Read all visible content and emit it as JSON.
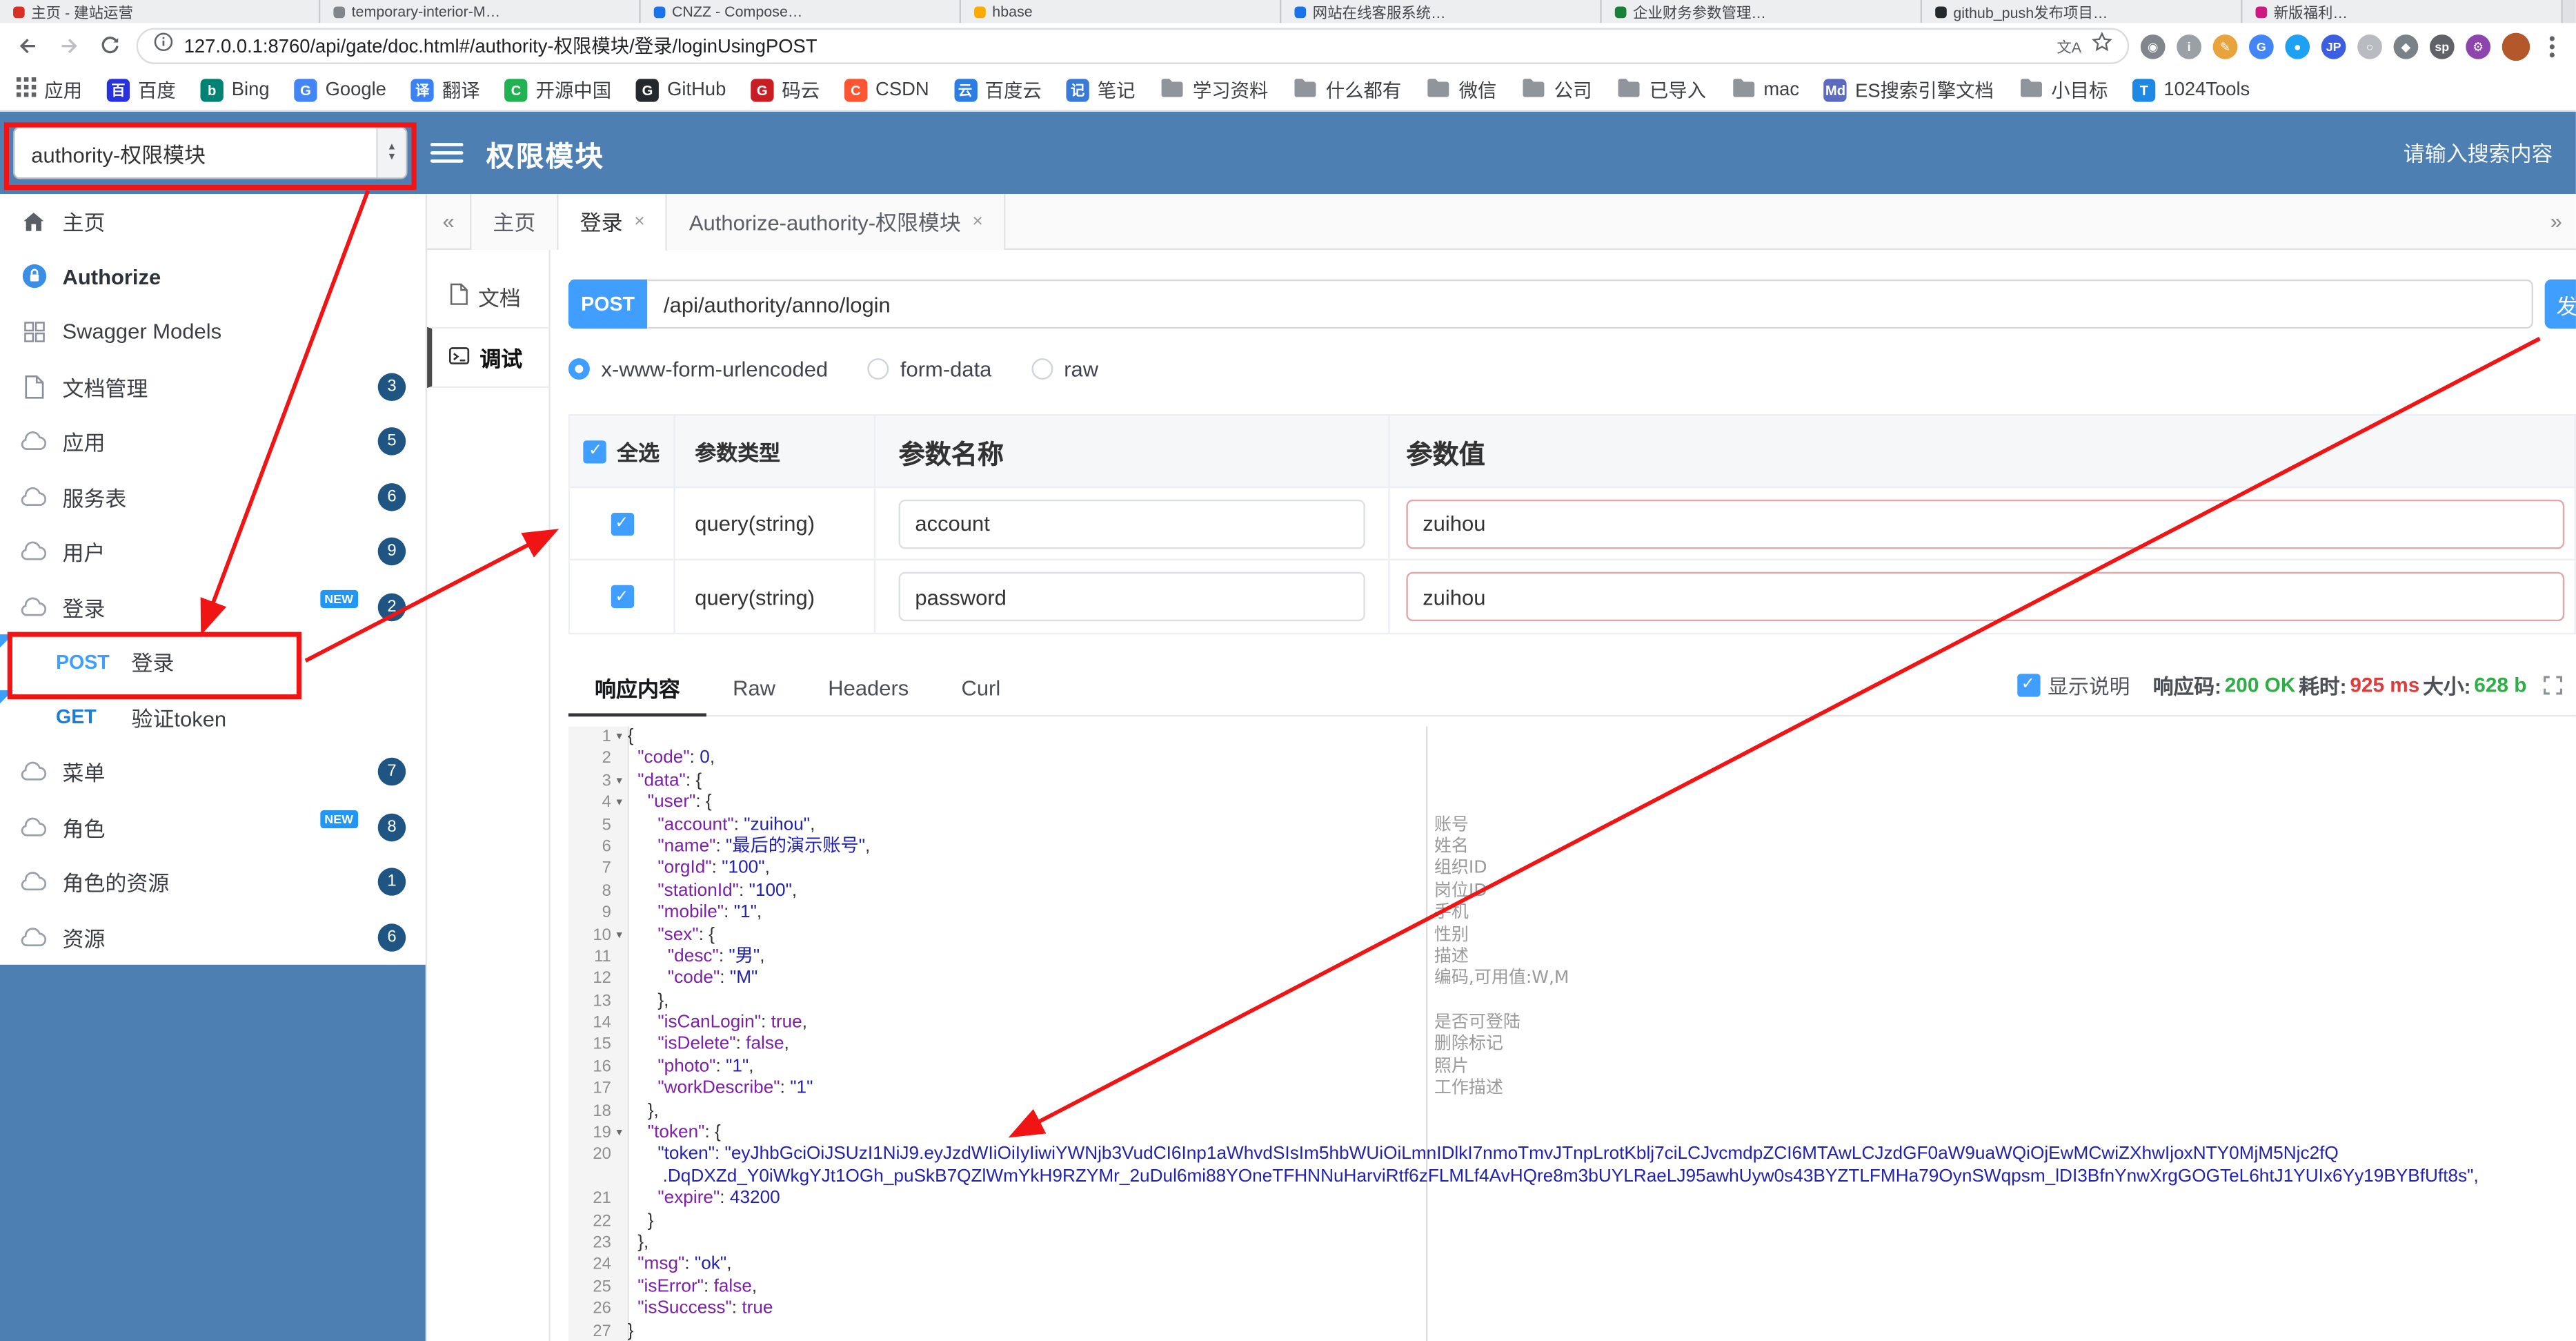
{
  "browser": {
    "tabs": [
      {
        "title": "主页 - 建站运营",
        "c": "#d93025"
      },
      {
        "title": "temporary-interior-M…",
        "c": "#80868b"
      },
      {
        "title": "CNZZ - Compose…",
        "c": "#1a73e8"
      },
      {
        "title": "hbase",
        "c": "#f9ab00"
      },
      {
        "title": "网站在线客服系统…",
        "c": "#1a73e8"
      },
      {
        "title": "企业财务参数管理…",
        "c": "#188038"
      },
      {
        "title": "github_push发布项目…",
        "c": "#24292e"
      },
      {
        "title": "新版福利…",
        "c": "#d01884"
      }
    ],
    "toolbar": {
      "url": "127.0.0.1:8760/api/gate/doc.html#/authority-权限模块/登录/loginUsingPOST",
      "translate_hint": "文A",
      "extensions": [
        {
          "name": "capture-extension-icon",
          "glyph": "◉",
          "c": "#80868b"
        },
        {
          "name": "info-extension-icon",
          "glyph": "i",
          "c": "#9aa0a6"
        },
        {
          "name": "pen-extension-icon",
          "glyph": "✎",
          "c": "#e8a33d"
        },
        {
          "name": "google-extension-icon",
          "glyph": "G",
          "c": "#4285f4"
        },
        {
          "name": "blue-dot-extension-icon",
          "glyph": "●",
          "c": "#1da1f2"
        },
        {
          "name": "jp-extension-icon",
          "glyph": "JP",
          "c": "#3b5fe0"
        },
        {
          "name": "circle-extension-icon",
          "glyph": "○",
          "c": "#b8bcc0"
        },
        {
          "name": "shield-extension-icon",
          "glyph": "◆",
          "c": "#7a8288"
        },
        {
          "name": "sp-extension-icon",
          "glyph": "sp",
          "c": "#5f6368"
        },
        {
          "name": "gear-extension-icon",
          "glyph": "⚙",
          "c": "#8e44ad"
        }
      ]
    },
    "bookmarks": [
      {
        "label": "应用",
        "type": "apps"
      },
      {
        "label": "百度",
        "type": "site",
        "glyph": "百",
        "c": "#2932e1"
      },
      {
        "label": "Bing",
        "type": "site",
        "glyph": "b",
        "c": "#008373"
      },
      {
        "label": "Google",
        "type": "site",
        "glyph": "G",
        "c": "#4285f4"
      },
      {
        "label": "翻译",
        "type": "site",
        "glyph": "译",
        "c": "#3b82f6"
      },
      {
        "label": "开源中国",
        "type": "site",
        "glyph": "C",
        "c": "#21b351"
      },
      {
        "label": "GitHub",
        "type": "site",
        "glyph": "G",
        "c": "#24292e"
      },
      {
        "label": "码云",
        "type": "site",
        "glyph": "G",
        "c": "#c71d23"
      },
      {
        "label": "CSDN",
        "type": "site",
        "glyph": "C",
        "c": "#fc5531"
      },
      {
        "label": "百度云",
        "type": "site",
        "glyph": "云",
        "c": "#2b7de1"
      },
      {
        "label": "笔记",
        "type": "site",
        "glyph": "记",
        "c": "#3a7bd5"
      },
      {
        "label": "学习资料",
        "type": "folder"
      },
      {
        "label": "什么都有",
        "type": "folder"
      },
      {
        "label": "微信",
        "type": "folder"
      },
      {
        "label": "公司",
        "type": "folder"
      },
      {
        "label": "已导入",
        "type": "folder"
      },
      {
        "label": "mac",
        "type": "folder"
      },
      {
        "label": "ES搜索引擎文档",
        "type": "site",
        "glyph": "Md",
        "c": "#5c6bc0"
      },
      {
        "label": "小目标",
        "type": "folder"
      },
      {
        "label": "1024Tools",
        "type": "site",
        "glyph": "T",
        "c": "#1e88e5"
      }
    ]
  },
  "header": {
    "service_select": "authority-权限模块",
    "title": "权限模块",
    "search_placeholder": "请输入搜索内容"
  },
  "sidebar": {
    "items": [
      {
        "icon": "home",
        "label": "主页"
      },
      {
        "icon": "auth",
        "label": "Authorize",
        "cls": "authorize"
      },
      {
        "icon": "models",
        "label": "Swagger Models"
      },
      {
        "icon": "docs",
        "label": "文档管理",
        "badge": "3"
      },
      {
        "icon": "cloud",
        "label": "应用",
        "badge": "5"
      },
      {
        "icon": "cloud",
        "label": "服务表",
        "badge": "6"
      },
      {
        "icon": "cloud",
        "label": "用户",
        "badge": "9"
      },
      {
        "icon": "cloud",
        "label": "登录",
        "badge": "2",
        "isNew": true
      },
      {
        "method": "POST",
        "label": "登录",
        "cls": "api post",
        "corner": true
      },
      {
        "method": "GET",
        "label": "验证token",
        "cls": "api get",
        "corner": true
      },
      {
        "icon": "cloud",
        "label": "菜单",
        "badge": "7"
      },
      {
        "icon": "cloud",
        "label": "角色",
        "badge": "8",
        "isNew": true
      },
      {
        "icon": "cloud",
        "label": "角色的资源",
        "badge": "1"
      },
      {
        "icon": "cloud",
        "label": "资源",
        "badge": "6"
      }
    ]
  },
  "doc_tabs": {
    "items": [
      {
        "label": "主页"
      },
      {
        "label": "登录",
        "closable": true,
        "cls": "active"
      },
      {
        "label": "Authorize-authority-权限模块",
        "closable": true
      }
    ]
  },
  "side_tabs": {
    "doc": "文档",
    "debug": "调试"
  },
  "request": {
    "method": "POST",
    "url": "/api/authority/anno/login",
    "send_label": "发送",
    "body_types": [
      {
        "label": "x-www-form-urlencoded",
        "cls": "on"
      },
      {
        "label": "form-data"
      },
      {
        "label": "raw"
      }
    ]
  },
  "params": {
    "select_all": "全选",
    "col_type": "参数类型",
    "col_name": "参数名称",
    "col_value": "参数值",
    "rows": [
      {
        "type": "query(string)",
        "name": "account",
        "value": "zuihou"
      },
      {
        "type": "query(string)",
        "name": "password",
        "value": "zuihou"
      }
    ]
  },
  "response": {
    "tabs": [
      {
        "label": "响应内容",
        "cls": "active"
      },
      {
        "label": "Raw"
      },
      {
        "label": "Headers"
      },
      {
        "label": "Curl"
      }
    ],
    "show_desc": "显示说明",
    "status_label": "响应码:",
    "status": "200 OK",
    "time_label": "耗时:",
    "time": "925 ms",
    "size_label": "大小:",
    "size": "628 b"
  },
  "editor": {
    "lines": [
      {
        "n": 1,
        "t": "{"
      },
      {
        "n": 2,
        "t": "  \"code\": 0,"
      },
      {
        "n": 3,
        "t": "  \"data\": {"
      },
      {
        "n": 4,
        "t": "    \"user\": {"
      },
      {
        "n": 5,
        "t": "      \"account\": \"zuihou\",",
        "note": "账号"
      },
      {
        "n": 6,
        "t": "      \"name\": \"最后的演示账号\",",
        "note": "姓名"
      },
      {
        "n": 7,
        "t": "      \"orgId\": \"100\",",
        "note": "组织ID"
      },
      {
        "n": 8,
        "t": "      \"stationId\": \"100\",",
        "note": "岗位ID"
      },
      {
        "n": 9,
        "t": "      \"mobile\": \"1\",",
        "note": "手机"
      },
      {
        "n": 10,
        "t": "      \"sex\": {",
        "note": "性别"
      },
      {
        "n": 11,
        "t": "        \"desc\": \"男\",",
        "note": "描述"
      },
      {
        "n": 12,
        "t": "        \"code\": \"M\"",
        "note": "编码,可用值:W,M"
      },
      {
        "n": 13,
        "t": "      },"
      },
      {
        "n": 14,
        "t": "      \"isCanLogin\": true,",
        "note": "是否可登陆"
      },
      {
        "n": 15,
        "t": "      \"isDelete\": false,",
        "note": "删除标记"
      },
      {
        "n": 16,
        "t": "      \"photo\": \"1\",",
        "note": "照片"
      },
      {
        "n": 17,
        "t": "      \"workDescribe\": \"1\"",
        "note": "工作描述"
      },
      {
        "n": 18,
        "t": "    },"
      },
      {
        "n": 19,
        "t": "    \"token\": {"
      },
      {
        "n": 20,
        "t": "      \"token\": \"eyJhbGciOiJSUzI1NiJ9.eyJzdWIiOiIyIiwiYWNjb3VudCI6Inp1aWhvdSIsIm5hbWUiOiLmnIDlkI7nmoTmvJTnpLrotKblj7ciLCJvcmdpZCI6MTAwLCJzdGF0aW9uaWQiOjEwMCwiZXhwIjoxNTY0MjM5Njc2fQ",
        "c": "tk-s"
      },
      {
        "n": null,
        "t": "       .DqDXZd_Y0iWkgYJt1OGh_puSkB7QZlWmYkH9RZYMr_2uDul6mi88YOneTFHNNuHarviRtf6zFLMLf4AvHQre8m3bUYLRaeLJ95awhUyw0s43BYZTLFMHa79OynSWqpsm_lDI3BfnYnwXrgGOGTeL6htJ1YUIx6Yy19BYBfUft8s\",",
        "c": "tk-s"
      },
      {
        "n": 21,
        "t": "      \"expire\": 43200"
      },
      {
        "n": 22,
        "t": "    }"
      },
      {
        "n": 23,
        "t": "  },"
      },
      {
        "n": 24,
        "t": "  \"msg\": \"ok\","
      },
      {
        "n": 25,
        "t": "  \"isError\": false,"
      },
      {
        "n": 26,
        "t": "  \"isSuccess\": true"
      },
      {
        "n": 27,
        "t": "}"
      }
    ]
  }
}
